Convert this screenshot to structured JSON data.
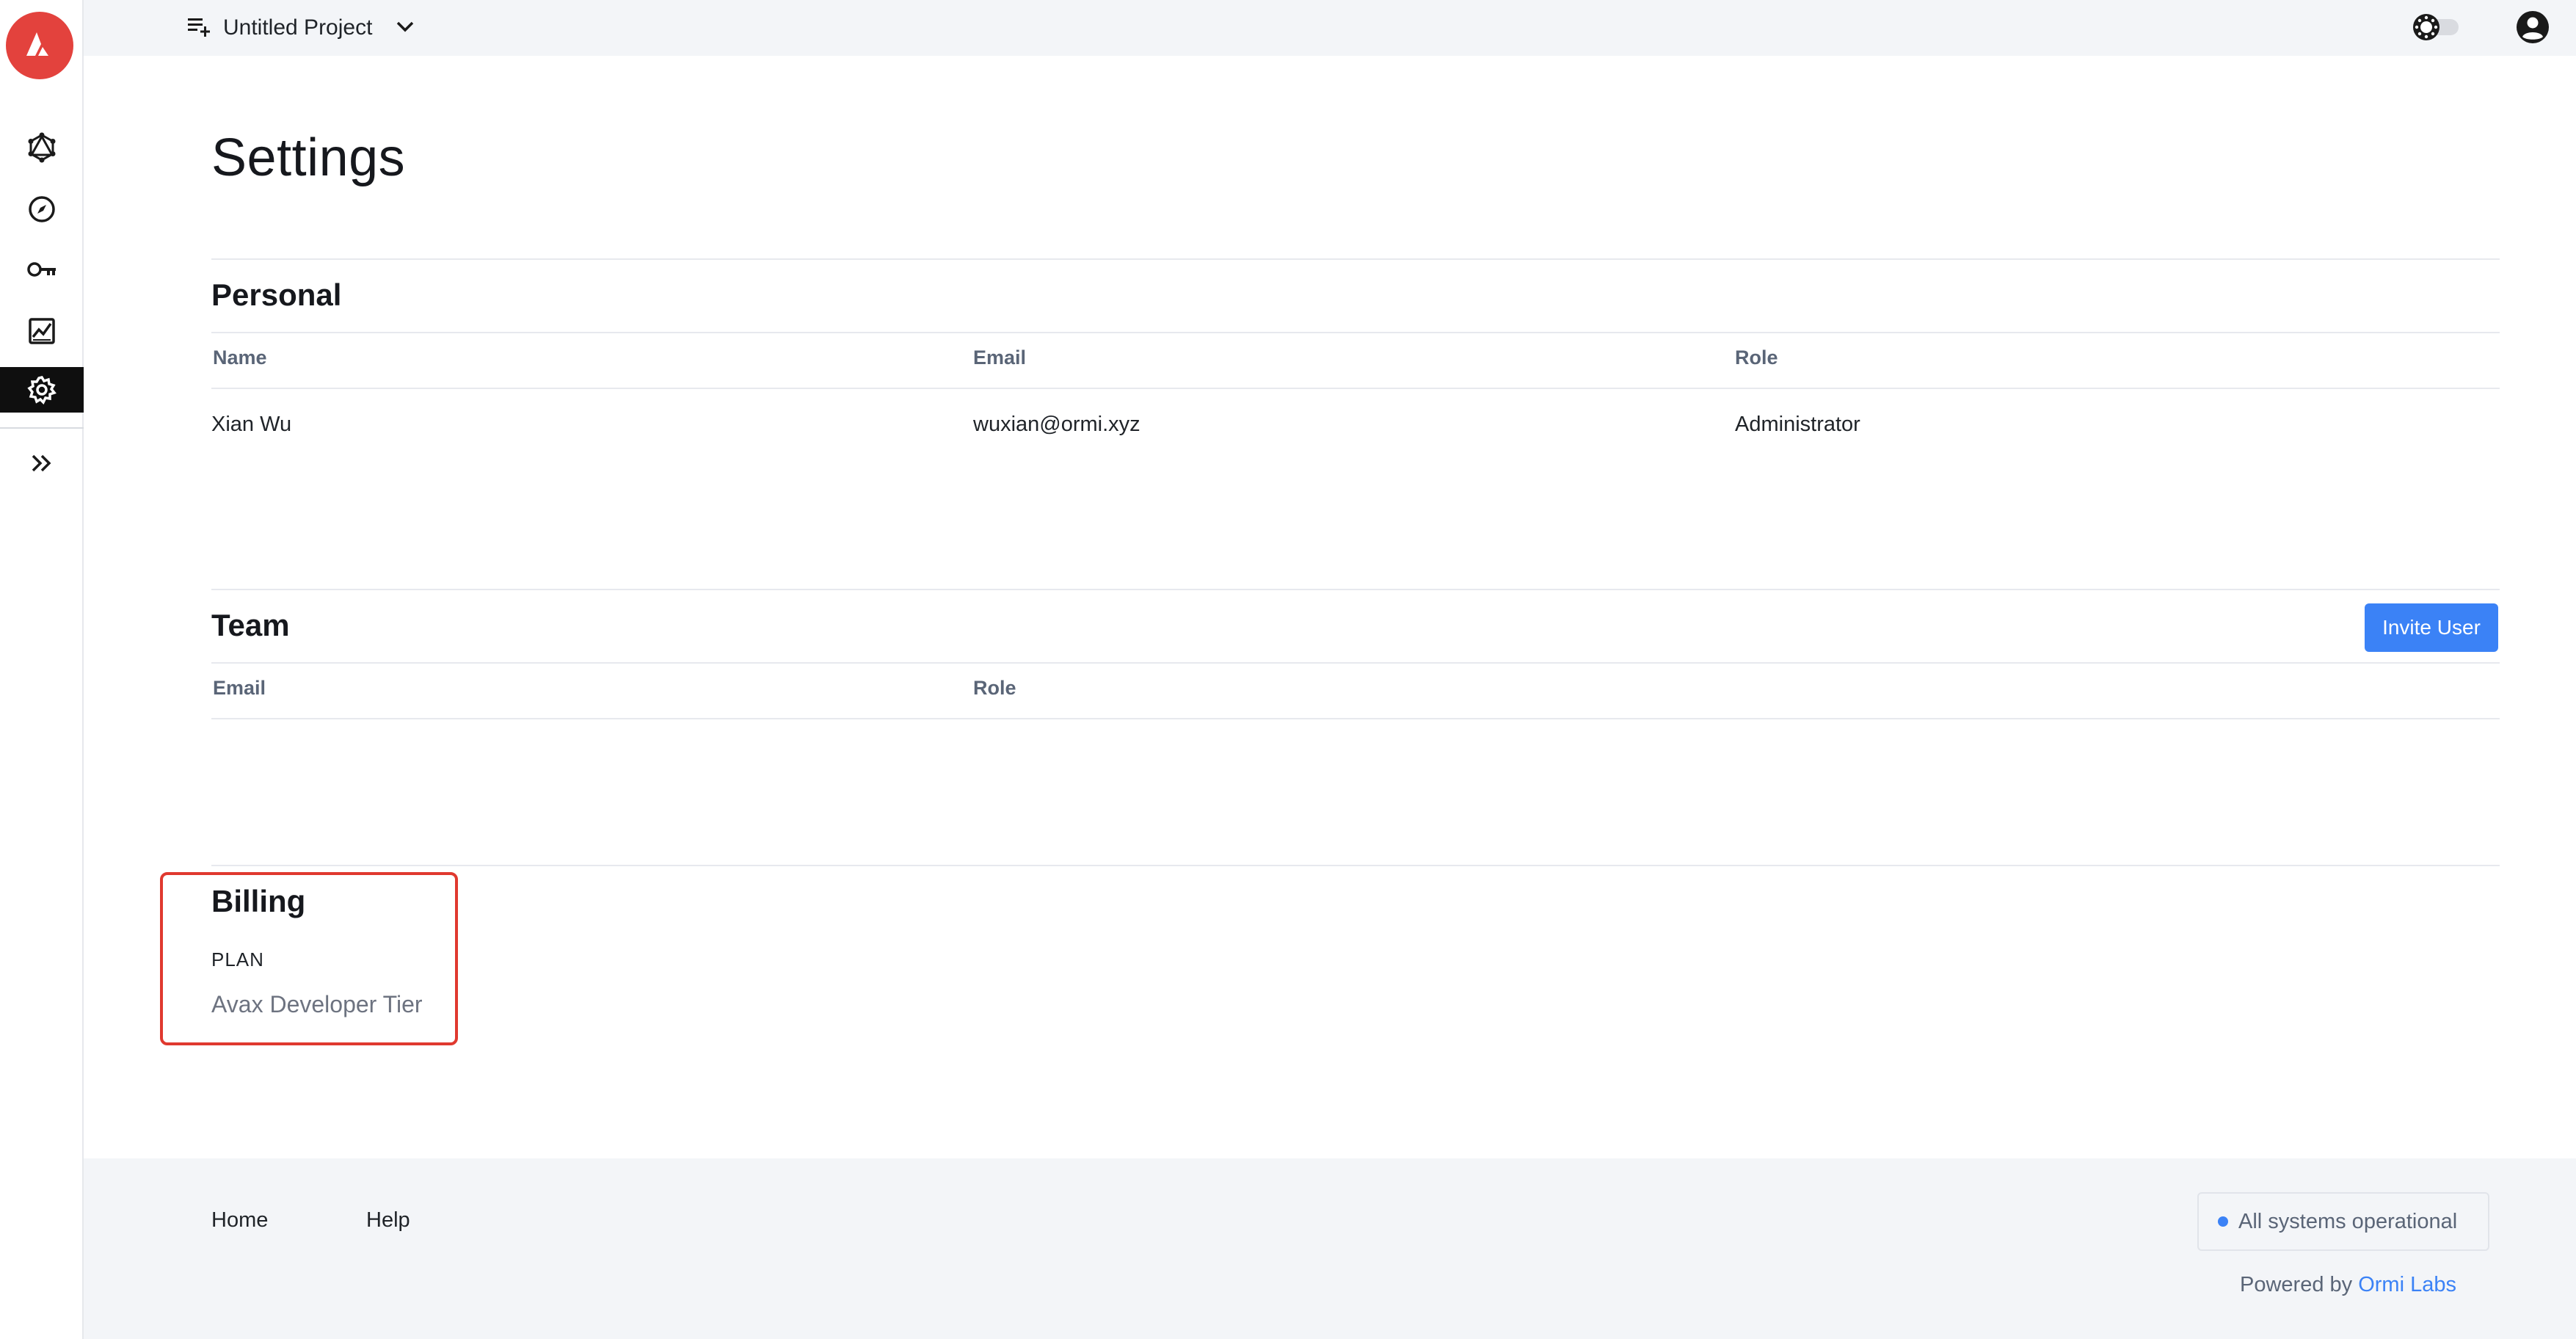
{
  "topbar": {
    "project_name": "Untitled Project"
  },
  "sidebar": {
    "items": [
      {
        "icon": "graphql-icon"
      },
      {
        "icon": "compass-icon"
      },
      {
        "icon": "key-icon"
      },
      {
        "icon": "analytics-icon"
      },
      {
        "icon": "gear-icon",
        "active": true
      },
      {
        "icon": "double-chevron-right-icon"
      }
    ]
  },
  "page": {
    "title": "Settings"
  },
  "personal": {
    "title": "Personal",
    "columns": [
      "Name",
      "Email",
      "Role"
    ],
    "row": {
      "name": "Xian Wu",
      "email": "wuxian@ormi.xyz",
      "role": "Administrator"
    }
  },
  "team": {
    "title": "Team",
    "invite_label": "Invite User",
    "columns": [
      "Email",
      "Role"
    ]
  },
  "billing": {
    "title": "Billing",
    "plan_label": "PLAN",
    "plan_value": "Avax Developer Tier"
  },
  "footer": {
    "links": [
      "Home",
      "Help"
    ],
    "status": "All systems operational",
    "powered_prefix": "Powered by",
    "powered_link": "Ormi Labs"
  },
  "colors": {
    "accent": "#3b82f6",
    "logo": "#e3423d",
    "highlight_box": "#e0392f",
    "active_nav": "#0f0f0f"
  }
}
